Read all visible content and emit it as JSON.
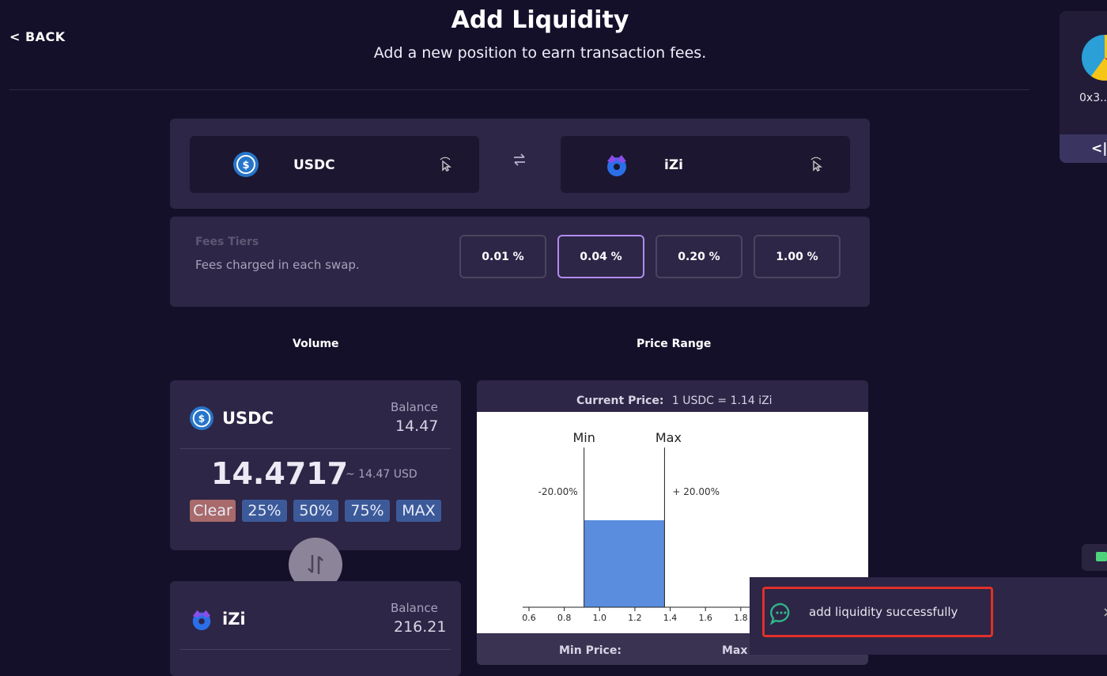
{
  "header": {
    "back_label": "< BACK",
    "title": "Add Liquidity",
    "subtitle": "Add a new position to earn transaction fees."
  },
  "wallet": {
    "address": "0x3..",
    "collapse_label": "<||"
  },
  "token_pair": {
    "token_a": "USDC",
    "token_b": "iZi"
  },
  "fees": {
    "title": "Fees Tiers",
    "description": "Fees charged in each swap.",
    "tiers": [
      "0.01 %",
      "0.04 %",
      "0.20 %",
      "1.00 %"
    ],
    "selected_index": 1
  },
  "sections": {
    "volume": "Volume",
    "price_range": "Price Range"
  },
  "volume": {
    "token_a": {
      "name": "USDC",
      "balance_label": "Balance",
      "balance": "14.47",
      "amount": "14.4717",
      "usd": "~ 14.47 USD",
      "buttons": [
        "Clear",
        "25%",
        "50%",
        "75%",
        "MAX"
      ]
    },
    "token_b": {
      "name": "iZi",
      "balance_label": "Balance",
      "balance": "216.21"
    }
  },
  "price_range": {
    "current_label": "Current Price:",
    "current_value": "1 USDC = 1.14 iZi",
    "min_label": "Min",
    "max_label": "Max",
    "min_pct": "-20.00%",
    "max_pct": "+ 20.00%",
    "min_price_label": "Min Price:",
    "max_price_label": "Max Price:"
  },
  "chart_data": {
    "type": "bar",
    "x_ticks": [
      0.6,
      0.8,
      1.0,
      1.2,
      1.4,
      1.6,
      1.8
    ],
    "xlim": [
      0.6,
      1.85
    ],
    "range": [
      0.912,
      1.368
    ],
    "current_price": 1.14,
    "bar_color": "#5b8ddf"
  },
  "toast": {
    "message": "add liquidity successfully"
  },
  "colors": {
    "accent": "#b08cf0",
    "highlight": "#e0302a",
    "clear_btn": "#a86a6a",
    "pct_btn": "#3c5a9a"
  }
}
